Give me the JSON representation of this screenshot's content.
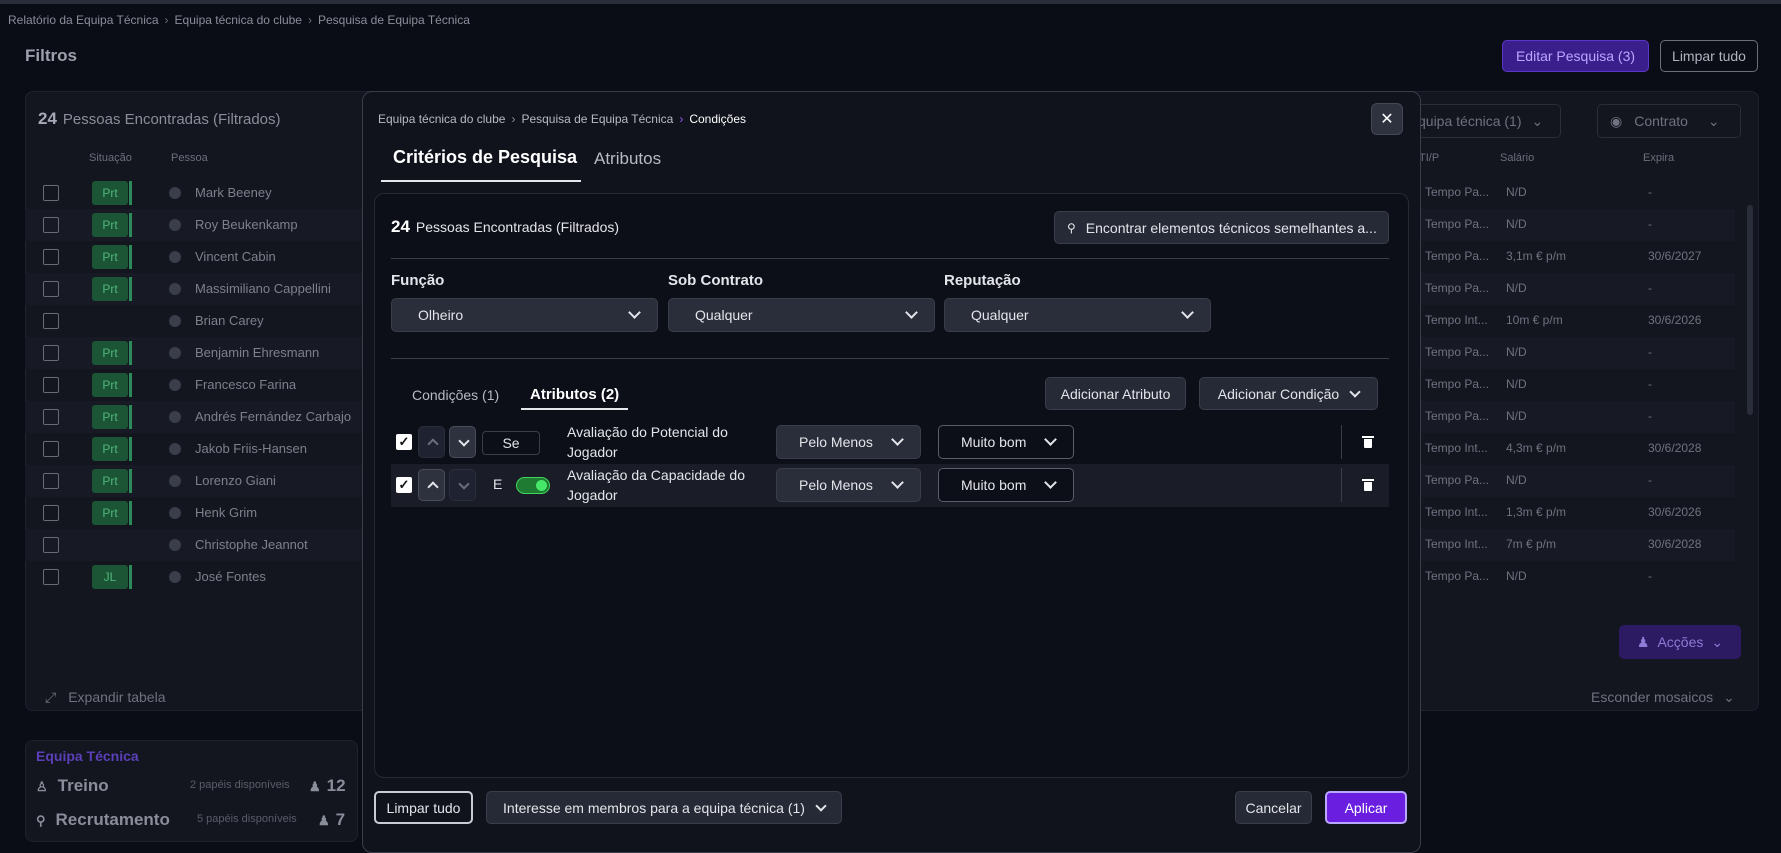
{
  "background": {
    "breadcrumb": [
      "Relatório da Equipa Técnica",
      "Equipa técnica do clube",
      "Pesquisa de Equipa Técnica"
    ],
    "title": "Filtros",
    "edit_search": "Editar Pesquisa (3)",
    "clear_all": "Limpar tudo",
    "count": "24",
    "count_label": "Pessoas Encontradas (Filtrados)",
    "col_situacao": "Situação",
    "col_pessoa": "Pessoa",
    "col_tp": "TI/P",
    "col_salario": "Salário",
    "col_expira": "Expira",
    "filter_staff": "quipa técnica (1)",
    "filter_contract": "Contrato",
    "rows": [
      {
        "tag": "Prt",
        "name": "Mark Beeney",
        "tp": "Tempo Pa...",
        "sal": "N/D",
        "exp": "-"
      },
      {
        "tag": "Prt",
        "name": "Roy Beukenkamp",
        "tp": "Tempo Pa...",
        "sal": "N/D",
        "exp": "-"
      },
      {
        "tag": "Prt",
        "name": "Vincent Cabin",
        "tp": "Tempo Pa...",
        "sal": "3,1m € p/m",
        "exp": "30/6/2027"
      },
      {
        "tag": "Prt",
        "name": "Massimiliano Cappellini",
        "tp": "Tempo Pa...",
        "sal": "N/D",
        "exp": "-"
      },
      {
        "tag": "",
        "name": "Brian Carey",
        "tp": "Tempo Int...",
        "sal": "10m € p/m",
        "exp": "30/6/2026"
      },
      {
        "tag": "Prt",
        "name": "Benjamin Ehresmann",
        "tp": "Tempo Pa...",
        "sal": "N/D",
        "exp": "-"
      },
      {
        "tag": "Prt",
        "name": "Francesco Farina",
        "tp": "Tempo Pa...",
        "sal": "N/D",
        "exp": "-"
      },
      {
        "tag": "Prt",
        "name": "Andrés Fernández Carbajo",
        "tp": "Tempo Pa...",
        "sal": "N/D",
        "exp": "-"
      },
      {
        "tag": "Prt",
        "name": "Jakob Friis-Hansen",
        "tp": "Tempo Int...",
        "sal": "4,3m € p/m",
        "exp": "30/6/2028"
      },
      {
        "tag": "Prt",
        "name": "Lorenzo Giani",
        "tp": "Tempo Pa...",
        "sal": "N/D",
        "exp": "-"
      },
      {
        "tag": "Prt",
        "name": "Henk Grim",
        "tp": "Tempo Int...",
        "sal": "1,3m € p/m",
        "exp": "30/6/2026"
      },
      {
        "tag": "",
        "name": "Christophe Jeannot",
        "tp": "Tempo Int...",
        "sal": "7m € p/m",
        "exp": "30/6/2028"
      },
      {
        "tag": "JL",
        "name": "José Fontes",
        "tp": "Tempo Pa...",
        "sal": "N/D",
        "exp": "-"
      }
    ],
    "actions": "Acções",
    "expand_table": "Expandir tabela",
    "hide_tiles": "Esconder mosaicos",
    "team_title": "Equipa Técnica",
    "team_training": "Treino",
    "team_training_sub": "2 papéis disponíveis",
    "team_training_num": "12",
    "team_recruit": "Recrutamento",
    "team_recruit_sub": "5 papéis disponíveis",
    "team_recruit_num": "7"
  },
  "modal": {
    "breadcrumb": [
      "Equipa técnica do clube",
      "Pesquisa de Equipa Técnica",
      "Condições"
    ],
    "tab_criteria": "Critérios de Pesquisa",
    "tab_attributes": "Atributos",
    "count": "24",
    "count_label": "Pessoas Encontradas (Filtrados)",
    "similar_button": "Encontrar elementos técnicos semelhantes a...",
    "filters": {
      "funcao_label": "Função",
      "funcao_value": "Olheiro",
      "contrato_label": "Sob Contrato",
      "contrato_value": "Qualquer",
      "reputacao_label": "Reputação",
      "reputacao_value": "Qualquer"
    },
    "subtab_conditions": "Condições (1)",
    "subtab_attributes": "Atributos (2)",
    "add_attribute": "Adicionar Atributo",
    "add_condition": "Adicionar Condição",
    "conditions": [
      {
        "logic": "Se",
        "name": "Avaliação do Potencial do Jogador",
        "comparison": "Pelo Menos",
        "value": "Muito bom",
        "checked": true
      },
      {
        "logic": "E",
        "name": "Avaliação da Capacidade do Jogador",
        "comparison": "Pelo Menos",
        "value": "Muito bom",
        "checked": true,
        "toggle_on": true
      }
    ],
    "footer": {
      "clear": "Limpar tudo",
      "interest": "Interesse em membros para a equipa técnica (1)",
      "cancel": "Cancelar",
      "apply": "Aplicar"
    },
    "colors": {
      "accent": "#6a1fe0",
      "toggle_on": "#46e86a"
    }
  }
}
